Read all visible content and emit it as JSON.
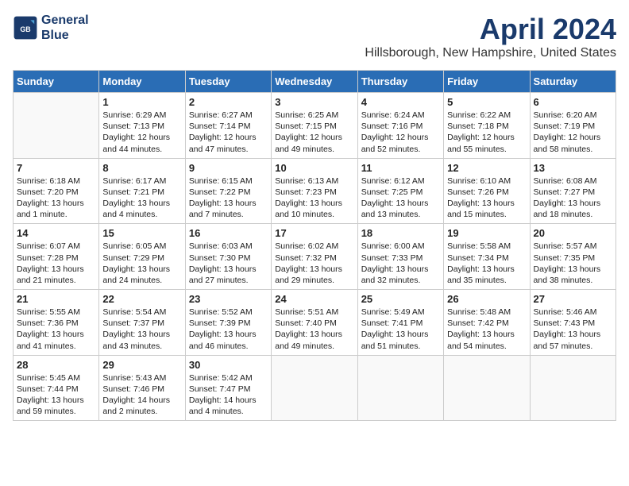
{
  "header": {
    "logo_line1": "General",
    "logo_line2": "Blue",
    "title": "April 2024",
    "subtitle": "Hillsborough, New Hampshire, United States"
  },
  "weekdays": [
    "Sunday",
    "Monday",
    "Tuesday",
    "Wednesday",
    "Thursday",
    "Friday",
    "Saturday"
  ],
  "weeks": [
    [
      {
        "day": "",
        "sunrise": "",
        "sunset": "",
        "daylight": ""
      },
      {
        "day": "1",
        "sunrise": "Sunrise: 6:29 AM",
        "sunset": "Sunset: 7:13 PM",
        "daylight": "Daylight: 12 hours and 44 minutes."
      },
      {
        "day": "2",
        "sunrise": "Sunrise: 6:27 AM",
        "sunset": "Sunset: 7:14 PM",
        "daylight": "Daylight: 12 hours and 47 minutes."
      },
      {
        "day": "3",
        "sunrise": "Sunrise: 6:25 AM",
        "sunset": "Sunset: 7:15 PM",
        "daylight": "Daylight: 12 hours and 49 minutes."
      },
      {
        "day": "4",
        "sunrise": "Sunrise: 6:24 AM",
        "sunset": "Sunset: 7:16 PM",
        "daylight": "Daylight: 12 hours and 52 minutes."
      },
      {
        "day": "5",
        "sunrise": "Sunrise: 6:22 AM",
        "sunset": "Sunset: 7:18 PM",
        "daylight": "Daylight: 12 hours and 55 minutes."
      },
      {
        "day": "6",
        "sunrise": "Sunrise: 6:20 AM",
        "sunset": "Sunset: 7:19 PM",
        "daylight": "Daylight: 12 hours and 58 minutes."
      }
    ],
    [
      {
        "day": "7",
        "sunrise": "Sunrise: 6:18 AM",
        "sunset": "Sunset: 7:20 PM",
        "daylight": "Daylight: 13 hours and 1 minute."
      },
      {
        "day": "8",
        "sunrise": "Sunrise: 6:17 AM",
        "sunset": "Sunset: 7:21 PM",
        "daylight": "Daylight: 13 hours and 4 minutes."
      },
      {
        "day": "9",
        "sunrise": "Sunrise: 6:15 AM",
        "sunset": "Sunset: 7:22 PM",
        "daylight": "Daylight: 13 hours and 7 minutes."
      },
      {
        "day": "10",
        "sunrise": "Sunrise: 6:13 AM",
        "sunset": "Sunset: 7:23 PM",
        "daylight": "Daylight: 13 hours and 10 minutes."
      },
      {
        "day": "11",
        "sunrise": "Sunrise: 6:12 AM",
        "sunset": "Sunset: 7:25 PM",
        "daylight": "Daylight: 13 hours and 13 minutes."
      },
      {
        "day": "12",
        "sunrise": "Sunrise: 6:10 AM",
        "sunset": "Sunset: 7:26 PM",
        "daylight": "Daylight: 13 hours and 15 minutes."
      },
      {
        "day": "13",
        "sunrise": "Sunrise: 6:08 AM",
        "sunset": "Sunset: 7:27 PM",
        "daylight": "Daylight: 13 hours and 18 minutes."
      }
    ],
    [
      {
        "day": "14",
        "sunrise": "Sunrise: 6:07 AM",
        "sunset": "Sunset: 7:28 PM",
        "daylight": "Daylight: 13 hours and 21 minutes."
      },
      {
        "day": "15",
        "sunrise": "Sunrise: 6:05 AM",
        "sunset": "Sunset: 7:29 PM",
        "daylight": "Daylight: 13 hours and 24 minutes."
      },
      {
        "day": "16",
        "sunrise": "Sunrise: 6:03 AM",
        "sunset": "Sunset: 7:30 PM",
        "daylight": "Daylight: 13 hours and 27 minutes."
      },
      {
        "day": "17",
        "sunrise": "Sunrise: 6:02 AM",
        "sunset": "Sunset: 7:32 PM",
        "daylight": "Daylight: 13 hours and 29 minutes."
      },
      {
        "day": "18",
        "sunrise": "Sunrise: 6:00 AM",
        "sunset": "Sunset: 7:33 PM",
        "daylight": "Daylight: 13 hours and 32 minutes."
      },
      {
        "day": "19",
        "sunrise": "Sunrise: 5:58 AM",
        "sunset": "Sunset: 7:34 PM",
        "daylight": "Daylight: 13 hours and 35 minutes."
      },
      {
        "day": "20",
        "sunrise": "Sunrise: 5:57 AM",
        "sunset": "Sunset: 7:35 PM",
        "daylight": "Daylight: 13 hours and 38 minutes."
      }
    ],
    [
      {
        "day": "21",
        "sunrise": "Sunrise: 5:55 AM",
        "sunset": "Sunset: 7:36 PM",
        "daylight": "Daylight: 13 hours and 41 minutes."
      },
      {
        "day": "22",
        "sunrise": "Sunrise: 5:54 AM",
        "sunset": "Sunset: 7:37 PM",
        "daylight": "Daylight: 13 hours and 43 minutes."
      },
      {
        "day": "23",
        "sunrise": "Sunrise: 5:52 AM",
        "sunset": "Sunset: 7:39 PM",
        "daylight": "Daylight: 13 hours and 46 minutes."
      },
      {
        "day": "24",
        "sunrise": "Sunrise: 5:51 AM",
        "sunset": "Sunset: 7:40 PM",
        "daylight": "Daylight: 13 hours and 49 minutes."
      },
      {
        "day": "25",
        "sunrise": "Sunrise: 5:49 AM",
        "sunset": "Sunset: 7:41 PM",
        "daylight": "Daylight: 13 hours and 51 minutes."
      },
      {
        "day": "26",
        "sunrise": "Sunrise: 5:48 AM",
        "sunset": "Sunset: 7:42 PM",
        "daylight": "Daylight: 13 hours and 54 minutes."
      },
      {
        "day": "27",
        "sunrise": "Sunrise: 5:46 AM",
        "sunset": "Sunset: 7:43 PM",
        "daylight": "Daylight: 13 hours and 57 minutes."
      }
    ],
    [
      {
        "day": "28",
        "sunrise": "Sunrise: 5:45 AM",
        "sunset": "Sunset: 7:44 PM",
        "daylight": "Daylight: 13 hours and 59 minutes."
      },
      {
        "day": "29",
        "sunrise": "Sunrise: 5:43 AM",
        "sunset": "Sunset: 7:46 PM",
        "daylight": "Daylight: 14 hours and 2 minutes."
      },
      {
        "day": "30",
        "sunrise": "Sunrise: 5:42 AM",
        "sunset": "Sunset: 7:47 PM",
        "daylight": "Daylight: 14 hours and 4 minutes."
      },
      {
        "day": "",
        "sunrise": "",
        "sunset": "",
        "daylight": ""
      },
      {
        "day": "",
        "sunrise": "",
        "sunset": "",
        "daylight": ""
      },
      {
        "day": "",
        "sunrise": "",
        "sunset": "",
        "daylight": ""
      },
      {
        "day": "",
        "sunrise": "",
        "sunset": "",
        "daylight": ""
      }
    ]
  ]
}
